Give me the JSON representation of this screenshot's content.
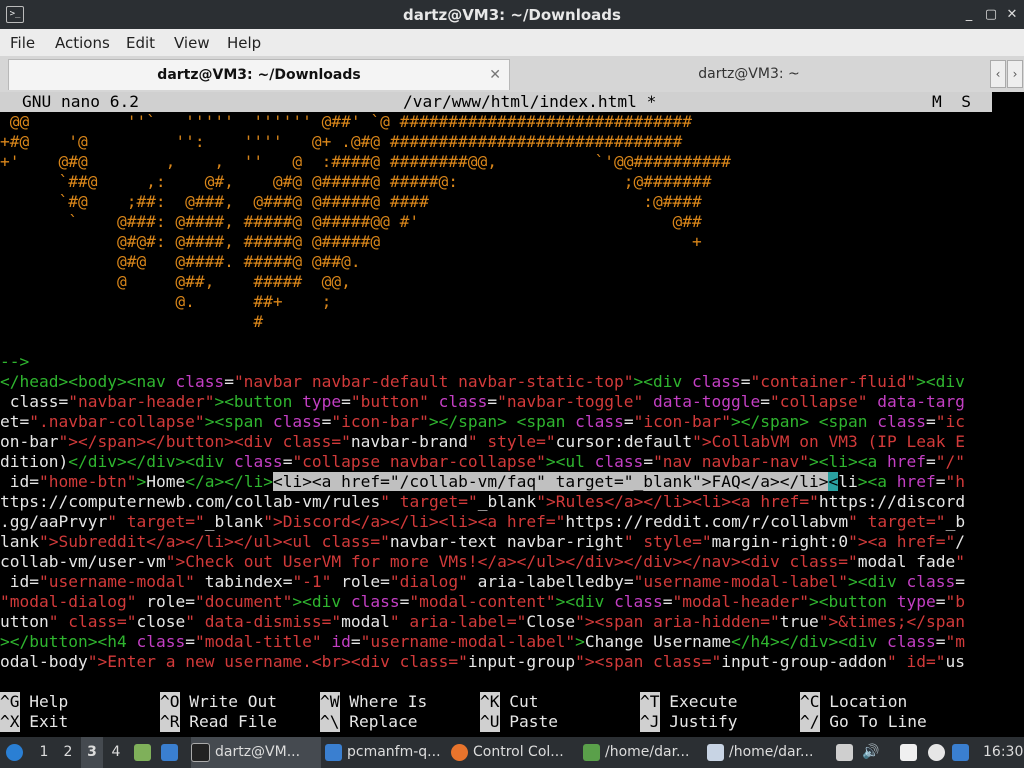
{
  "window": {
    "title": "dartz@VM3: ~/Downloads",
    "app_icon": ">_",
    "buttons": [
      "_",
      "▢",
      "✕"
    ]
  },
  "menu": [
    "File",
    "Actions",
    "Edit",
    "View",
    "Help"
  ],
  "tabs": [
    {
      "label": "dartz@VM3: ~/Downloads",
      "active": true
    },
    {
      "label": "dartz@VM3: ~",
      "active": false
    }
  ],
  "nano": {
    "version": "GNU nano 6.2",
    "file": "/var/www/html/index.html *",
    "flags": "M  S"
  },
  "ascii_art": [
    " @@          ''`   '''''  '''''' @##' `@ ##############################",
    "+#@    '@         '':    ''''   @+ .@#@ ##############################",
    "+'    @#@        ,    ,  ''   @  :####@ ########@@,          `'@@##########",
    "      `##@     ,:    @#,    @#@ @#####@ #####@:                 ;@#######",
    "      `#@    ;##:  @###,  @###@ @#####@ ####                      :@####",
    "       `    @###: @####, #####@ @#####@@ #'                          @##",
    "            @#@#: @####, #####@ @#####@                                +",
    "            @#@   @####. #####@ @##@.",
    "            @     @##,    #####  @@,",
    "                  @.      ##+    ;",
    "                          #"
  ],
  "comment_end": "-->",
  "code_lines": [
    "</head><body><nav class=\"navbar navbar-default navbar-static-top\"><div class=\"container-fluid\"><div",
    " class=\"navbar-header\"><button type=\"button\" class=\"navbar-toggle\" data-toggle=\"collapse\" data-targ",
    "et=\".navbar-collapse\"><span class=\"icon-bar\"></span> <span class=\"icon-bar\"></span> <span class=\"ic",
    "on-bar\"></span></button><div class=\"navbar-brand\" style=\"cursor:default\">CollabVM on VM3 (IP Leak E",
    "dition)</div></div><div class=\"collapse navbar-collapse\"><ul class=\"nav navbar-nav\"><li><a href=\"/\"",
    " id=\"home-btn\">Home</a></li><li><a href=\"/collab-vm/faq\" target=\"_blank\">FAQ</a></li><li><a href=\"h",
    "ttps://computernewb.com/collab-vm/rules\" target=\"_blank\">Rules</a></li><li><a href=\"https://discord",
    ".gg/aaPrvyr\" target=\"_blank\">Discord</a></li><li><a href=\"https://reddit.com/r/collabvm\" target=\"_b",
    "lank\">Subreddit</a></li></ul><ul class=\"navbar-text navbar-right\" style=\"margin-right:0\"><a href=\"/",
    "collab-vm/user-vm\">Check out UserVM for more VMs!</a></ul></div></div></nav><div class=\"modal fade\"",
    " id=\"username-modal\" tabindex=\"-1\" role=\"dialog\" aria-labelledby=\"username-modal-label\"><div class=",
    "\"modal-dialog\" role=\"document\"><div class=\"modal-content\"><div class=\"modal-header\"><button type=\"b",
    "utton\" class=\"close\" data-dismiss=\"modal\" aria-label=\"Close\"><span aria-hidden=\"true\">&times;</span",
    "></button><h4 class=\"modal-title\" id=\"username-modal-label\">Change Username</h4></div><div class=\"m",
    "odal-body\">Enter a new username.<br><div class=\"input-group\"><span class=\"input-group-addon\" id=\"us"
  ],
  "shortcuts": [
    {
      "key": "^G",
      "label": "Help"
    },
    {
      "key": "^O",
      "label": "Write Out"
    },
    {
      "key": "^W",
      "label": "Where Is"
    },
    {
      "key": "^K",
      "label": "Cut"
    },
    {
      "key": "^T",
      "label": "Execute"
    },
    {
      "key": "^C",
      "label": "Location"
    },
    {
      "key": "^X",
      "label": "Exit"
    },
    {
      "key": "^R",
      "label": "Read File"
    },
    {
      "key": "^\\",
      "label": "Replace"
    },
    {
      "key": "^U",
      "label": "Paste"
    },
    {
      "key": "^J",
      "label": "Justify"
    },
    {
      "key": "^/",
      "label": "Go To Line"
    }
  ],
  "taskbar": {
    "workspaces": [
      "1",
      "2",
      "3",
      "4"
    ],
    "active_workspace": "3",
    "tasks": [
      {
        "label": "dartz@VM...",
        "icon": "terminal-icon"
      },
      {
        "label": "pcmanfm-q...",
        "icon": "folder-icon"
      },
      {
        "label": "Control Col...",
        "icon": "firefox-icon"
      },
      {
        "label": "/home/dar...",
        "icon": "text-file-icon"
      },
      {
        "label": "/home/dar...",
        "icon": "editor-icon"
      }
    ],
    "clock": "16:30"
  },
  "colors": {
    "titlebar": "#2b2f33",
    "terminal_bg": "#000000",
    "art": "#d9861a",
    "tag": "#2fb52f",
    "attr": "#c43fc4",
    "string": "#d23a3a",
    "selection": "#c0c0c0",
    "cursor": "#2aa1a1"
  }
}
